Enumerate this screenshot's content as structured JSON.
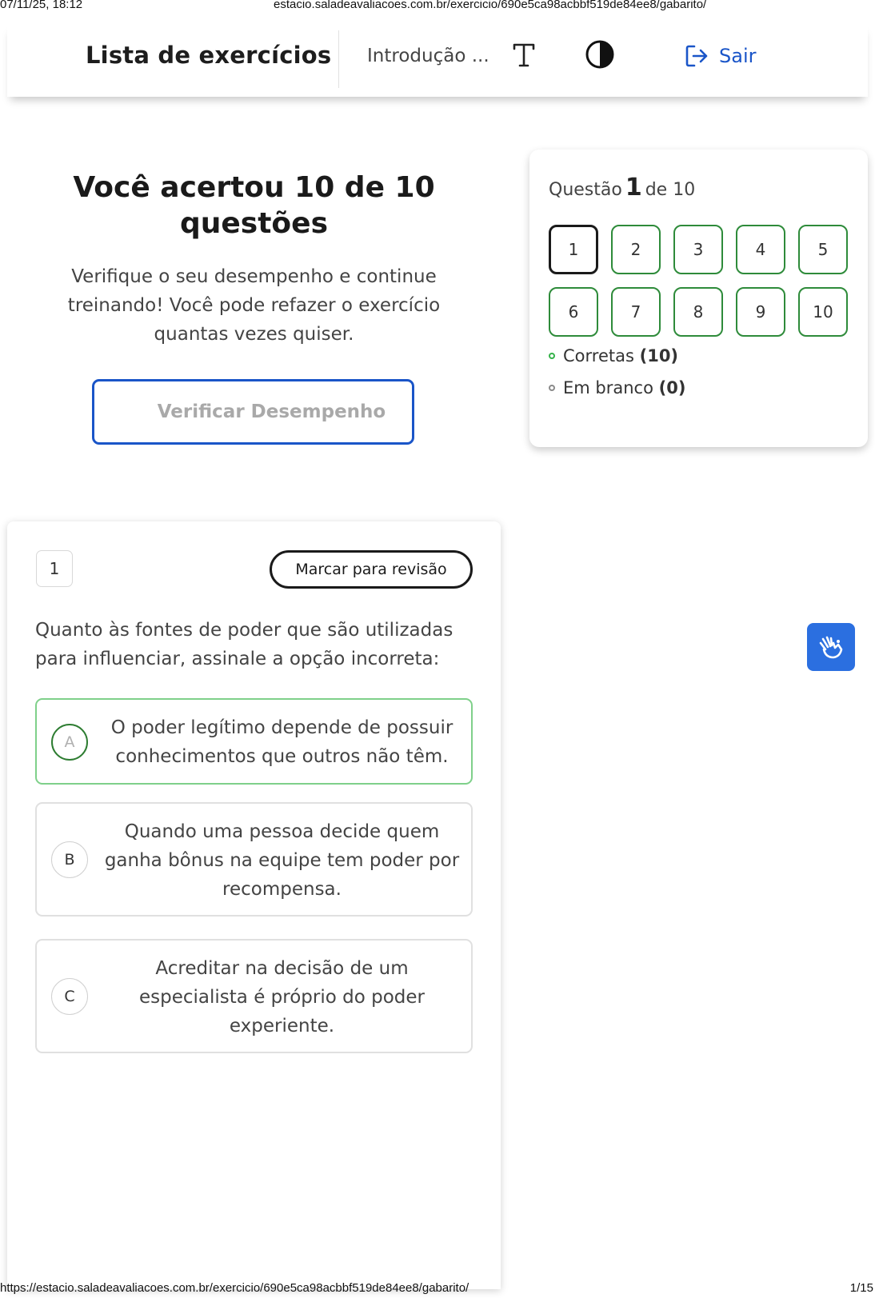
{
  "print": {
    "datetime": "07/11/25, 18:12",
    "page_title": "estacio.saladeavaliacoes.com.br/exercicio/690e5ca98acbbf519de84ee8/gabarito/",
    "url": "https://estacio.saladeavaliacoes.com.br/exercicio/690e5ca98acbbf519de84ee8/gabarito/",
    "page": "1/15"
  },
  "header": {
    "title": "Lista de exercícios",
    "course": "Introdução ...",
    "font_icon": "font-size-icon",
    "contrast_icon": "contrast-icon",
    "exit_icon": "logout-icon",
    "exit_label": "Sair",
    "accent": "#1a55c8"
  },
  "result": {
    "title": "Você acertou 10 de 10 questões",
    "subtitle": "Verifique o seu desempenho e continue treinando! Você pode refazer o exercício quantas vezes quiser.",
    "button_label": "Verificar Desempenho"
  },
  "navigator": {
    "label_prefix": "Questão",
    "current": "1",
    "label_suffix": "de 10",
    "questions": [
      "1",
      "2",
      "3",
      "4",
      "5",
      "6",
      "7",
      "8",
      "9",
      "10"
    ],
    "correct_color": "#2e8b3a",
    "legend": {
      "correct_label": "Corretas",
      "correct_count": "(10)",
      "blank_label": "Em branco",
      "blank_count": "(0)"
    }
  },
  "question": {
    "number": "1",
    "mark_label": "Marcar para revisão",
    "stem": "Quanto às fontes de poder que são utilizadas para influenciar, assinale a opção incorreta:",
    "options": [
      {
        "letter": "A",
        "text": "O poder legítimo depende de possuir conhecimentos que outros não têm.",
        "correct": true
      },
      {
        "letter": "B",
        "text": "Quando uma pessoa decide quem ganha bônus na equipe tem poder por recompensa.",
        "correct": false
      },
      {
        "letter": "C",
        "text": "Acreditar na decisão de um especialista é próprio do poder experiente.",
        "correct": false
      }
    ]
  },
  "accessibility": {
    "icon": "sign-language-icon"
  }
}
